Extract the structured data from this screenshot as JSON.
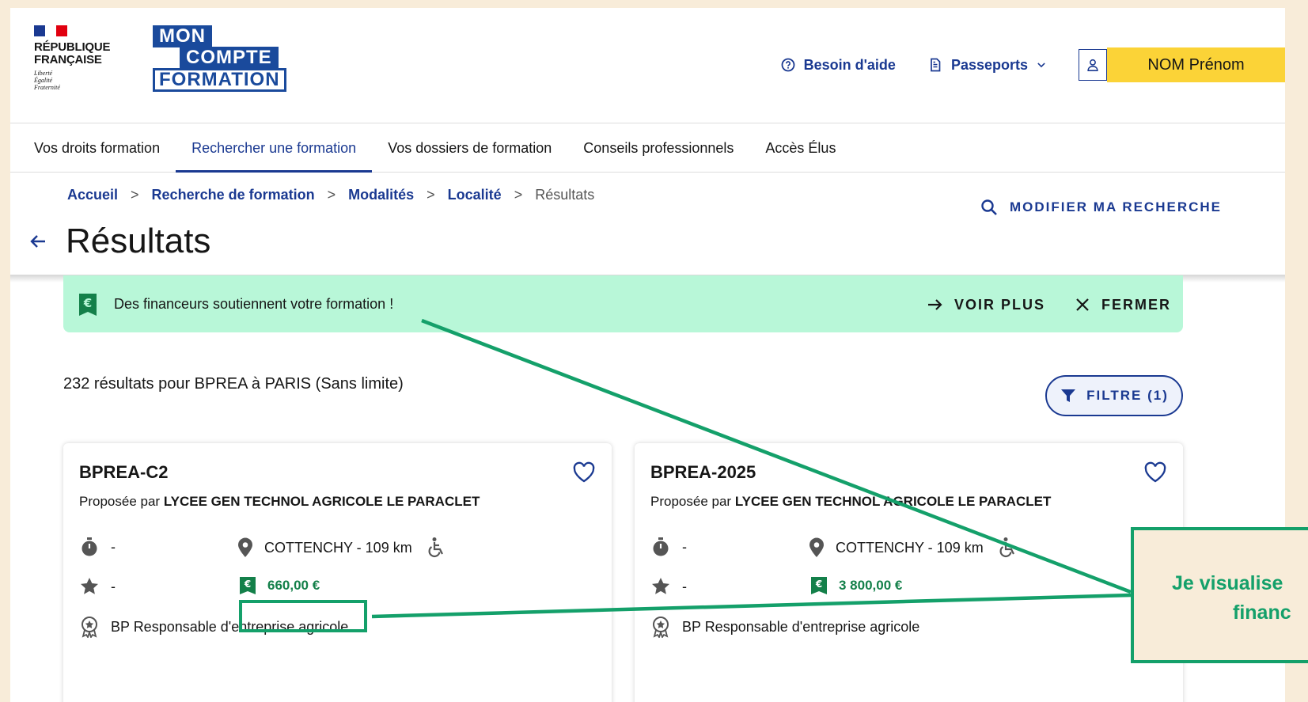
{
  "header": {
    "republique": "RÉPUBLIQUE\nFRANÇAISE",
    "motto": [
      "Liberté",
      "Égalité",
      "Fraternité"
    ],
    "logo": [
      "MON",
      "COMPTE",
      "FORMATION"
    ],
    "help": "Besoin d'aide",
    "passports": "Passeports",
    "user_name": "NOM Prénom"
  },
  "nav": [
    "Vos droits formation",
    "Rechercher une formation",
    "Vos dossiers de formation",
    "Conseils professionnels",
    "Accès Élus"
  ],
  "breadcrumb": [
    "Accueil",
    "Recherche de formation",
    "Modalités",
    "Localité",
    "Résultats"
  ],
  "modify_search": "MODIFIER MA RECHERCHE",
  "page_title": "Résultats",
  "banner": {
    "text": "Des financeurs soutiennent votre formation !",
    "more": "VOIR PLUS",
    "close": "FERMER"
  },
  "results_count": "232 résultats pour BPREA à PARIS (Sans limite)",
  "filter": "FILTRE (1)",
  "cards": [
    {
      "title": "BPREA-C2",
      "proposed_by": "Proposée par",
      "provider": "LYCEE GEN TECHNOL AGRICOLE LE PARACLET",
      "duration": "-",
      "location": "COTTENCHY - 109 km",
      "rating": "-",
      "price": "660,00 €",
      "certification": "BP Responsable d'entreprise agricole"
    },
    {
      "title": "BPREA-2025",
      "proposed_by": "Proposée par",
      "provider": "LYCEE GEN TECHNOL AGRICOLE LE PARACLET",
      "duration": "-",
      "location": "COTTENCHY - 109 km",
      "rating": "-",
      "price": "3 800,00 €",
      "certification": "BP Responsable d'entreprise agricole"
    }
  ],
  "annotation": {
    "line1": "Je visualise",
    "line2": "financ"
  },
  "colors": {
    "primary": "#1a3991",
    "accent_yellow": "#fbd337",
    "banner_green": "#b8f7d8",
    "annotation_green": "#14a06a",
    "background": "#f8ecd9"
  }
}
